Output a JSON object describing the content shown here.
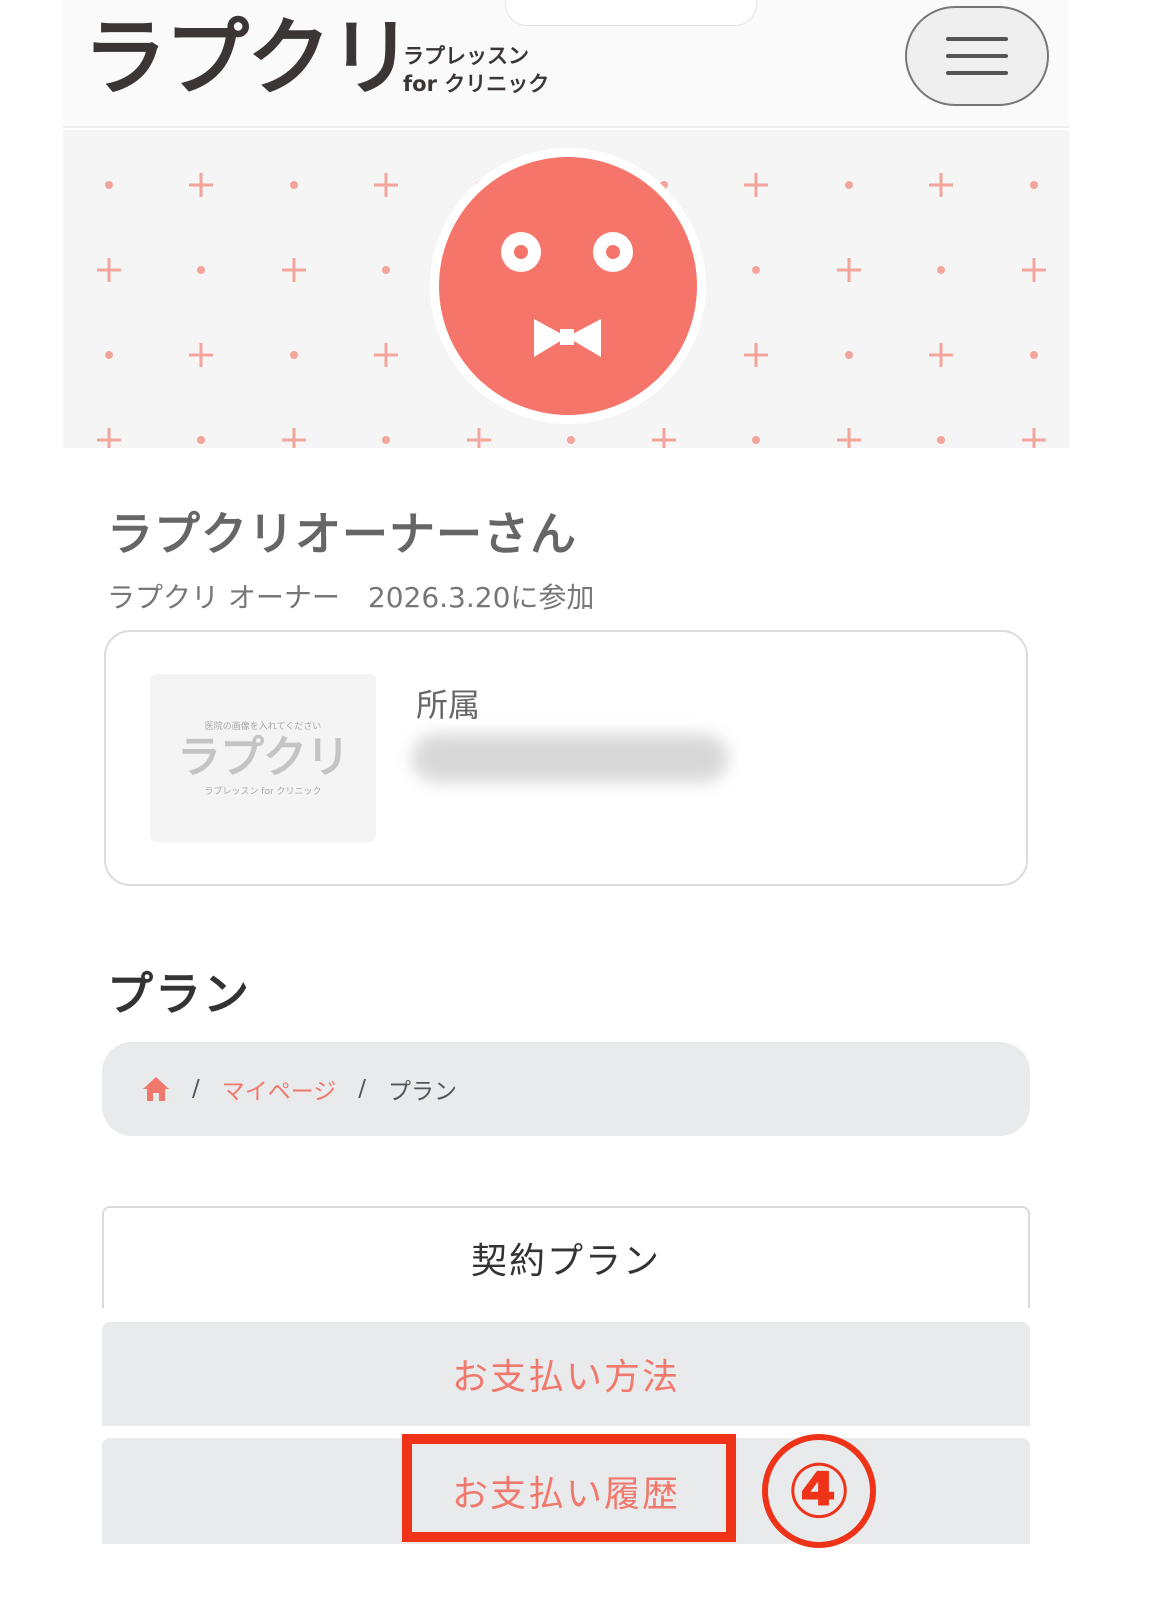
{
  "header": {
    "logo_main": "ラプクリ",
    "logo_sub_line1": "ラプレッスン",
    "logo_sub_line2": "for クリニック",
    "menu_icon": "hamburger-menu-icon"
  },
  "profile": {
    "name": "ラプクリオーナーさん",
    "meta": "ラプクリ オーナー　2026.3.20に参加",
    "affiliation_label": "所属",
    "clinic_placeholder": {
      "top": "医院の画像を入れてください",
      "logo": "ラプクリ",
      "bottom": "ラプレッスン for クリニック"
    }
  },
  "plan": {
    "title": "プラン",
    "breadcrumb": {
      "home_icon": "home-icon",
      "separator": "/",
      "mypage": "マイページ",
      "current": "プラン"
    },
    "tabs": [
      {
        "label": "契約プラン",
        "active": true
      },
      {
        "label": "お支払い方法",
        "active": false
      },
      {
        "label": "お支払い履歴",
        "active": false
      }
    ]
  },
  "annotation": {
    "step": "④"
  },
  "colors": {
    "accent": "#f0786c",
    "avatar": "#f6756a",
    "highlight": "#ee3318",
    "tab_bg": "#e9eaec"
  }
}
